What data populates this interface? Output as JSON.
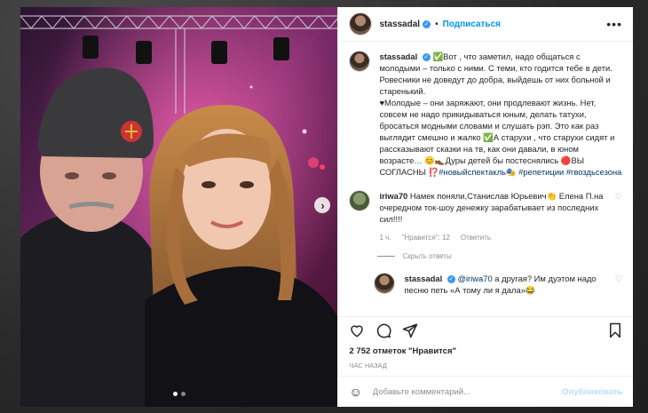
{
  "post": {
    "username": "stassadal",
    "follow_label": "Подписаться",
    "separator": "•",
    "more_label": "•••",
    "caption_segments": {
      "text": "✅Вот , что заметил, надо общаться с молодыми – только с ними. С теми, кто годится тебе в дети. Ровесники не доведут до добра, выйдешь от них больной и старенький.\n♥Молодые – они заряжают, они продлевают жизнь. Нет, совсем не надо прикидываться юным, делать татухи, бросаться модными словами и слушать рэп. Это как раз выглядит смешно и жалко ✅А старухи , что старухи сидят и рассказывают сказки на тв, как они давали, в юном возрасте… 😊👞Дуры детей бы постеснялись 🔴ВЫ СОГЛАСНЫ ⁉️",
      "hashtags_inline": "#новыйспектакль🎭",
      "hashtags_end": "#репетиции #гвоздьсезона"
    },
    "likes": "2 752 отметок \"Нравится\"",
    "time_ago": "час назад",
    "comment_placeholder": "Добавьте комментарий...",
    "publish_label": "Опубликовать"
  },
  "comments": [
    {
      "username": "iriwa70",
      "text": "Намек поняли,Станислав Юрьевич👏 Елена П.на очередном ток-шоу денежку зарабатывает из последних сил!!!!",
      "age": "1 ч.",
      "likes": "\"Нравится\": 12",
      "reply_label": "Ответить",
      "hide_replies": "Скрыть ответы",
      "replies": [
        {
          "username": "stassadal",
          "mention": "@iriwa70",
          "text": " а другая? Им дуэтом надо песню петь «А тому ли я дала»😂"
        }
      ]
    }
  ],
  "icons": [
    "close-icon",
    "verified-icon",
    "more-icon",
    "next-arrow-icon",
    "heart-icon",
    "comment-icon",
    "share-icon",
    "bookmark-icon",
    "emoji-icon"
  ],
  "colors": {
    "accent": "#0095f6",
    "verified": "#3897f0",
    "muted": "#8e8e8e",
    "publish_disabled": "#b2dffc"
  },
  "carousel": {
    "slides": 2,
    "active": 1
  }
}
